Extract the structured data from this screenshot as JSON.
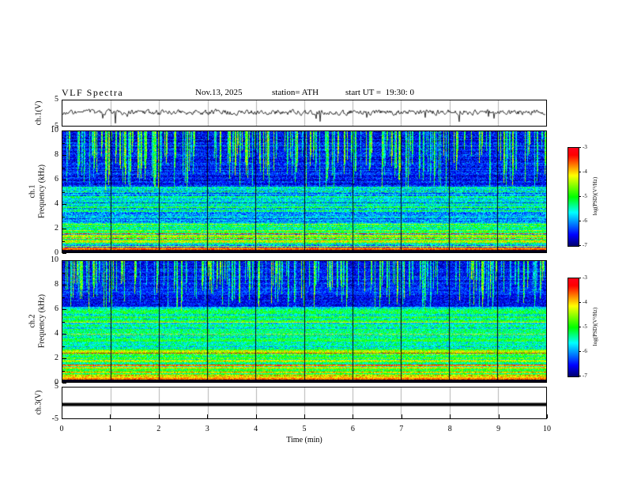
{
  "header": {
    "title": "VLF Spectra",
    "date": "Nov.13, 2025",
    "station": "station= ATH",
    "start_ut": "start UT =  19:30: 0"
  },
  "axes": {
    "x": {
      "label": "Time (min)",
      "min": 0,
      "max": 10,
      "ticks": [
        0,
        1,
        2,
        3,
        4,
        5,
        6,
        7,
        8,
        9,
        10
      ]
    },
    "voltage": {
      "min": -5,
      "max": 5,
      "tick_labels": [
        5,
        -5
      ]
    },
    "frequency": {
      "min": 0,
      "max": 10,
      "ticks": [
        0,
        2,
        4,
        6,
        8,
        10
      ],
      "minor_ticks": [
        1,
        3,
        5,
        7,
        9
      ]
    },
    "colorbar": {
      "label": "log(PSD)(V²/Hz)",
      "min": -7,
      "max": -3,
      "ticks": [
        -3,
        -4,
        -5,
        -6,
        -7
      ]
    }
  },
  "chart_data": [
    {
      "type": "line",
      "panel": "ch1-waveform",
      "ylabel": "ch.1(V)",
      "ylim": [
        -5,
        5
      ],
      "xlim": [
        0,
        10
      ],
      "description": "Broadband noisy voltage trace fluctuating around +0.3 V (~±1 V) with intermittent negative spikes reaching about -3 V",
      "signal": {
        "seed": 9,
        "mean": 0.3,
        "noise_amp": 0.8,
        "smooth": 0.45,
        "spike_rate": 0.02,
        "spike_scale": 1.6
      }
    },
    {
      "type": "heatmap",
      "panel": "ch1-spectrogram",
      "channel": "ch.1",
      "ylabel": "Frequency (kHz)",
      "ylim": [
        0,
        10
      ],
      "xlim": [
        0,
        10
      ],
      "value_range": [
        -7,
        -3
      ],
      "colorbar_label": "log(PSD)(V²/Hz)",
      "description": "VLF spectrogram: intense yellow-red horizontal bands below ~2.3 kHz, moderate blue-green 2.3-5.4 kHz with horizontal striping, dark blue above 5.4 kHz crossed by dense vertical sferic streaks; black vertical gridlines every minute",
      "texture": {
        "seed": 101,
        "bands": [
          {
            "f0": 0.0,
            "f1": 0.16,
            "base": -7.5,
            "rowVar": 0.05,
            "cellVar": 0.05,
            "lineProb": 0,
            "lineBoost": 0
          },
          {
            "f0": 0.16,
            "f1": 0.36,
            "base": -3.9,
            "rowVar": 0.35,
            "cellVar": 0.35,
            "lineProb": 0.4,
            "lineBoost": 0.5
          },
          {
            "f0": 0.36,
            "f1": 0.62,
            "base": -6.1,
            "rowVar": 0.5,
            "cellVar": 0.5,
            "lineProb": 0.25,
            "lineBoost": 1.5
          },
          {
            "f0": 0.62,
            "f1": 2.35,
            "base": -5.0,
            "rowVar": 0.85,
            "cellVar": 0.6,
            "lineProb": 0.2,
            "lineBoost": 1.2
          },
          {
            "f0": 2.35,
            "f1": 5.4,
            "base": -5.85,
            "rowVar": 0.5,
            "cellVar": 0.55,
            "lineProb": 0.12,
            "lineBoost": 0.9
          },
          {
            "f0": 5.4,
            "f1": 10.01,
            "base": -6.5,
            "rowVar": 0.22,
            "cellVar": 0.45,
            "lineProb": 0.04,
            "lineBoost": 0.5
          }
        ],
        "streaks": {
          "prob": 0.3,
          "fminLo": 5.0,
          "fminHi": 8.6,
          "level": -5.1,
          "levelVar": 0.7
        }
      }
    },
    {
      "type": "heatmap",
      "panel": "ch2-spectrogram",
      "channel": "ch.2",
      "ylabel": "Frequency (kHz)",
      "ylim": [
        0,
        10
      ],
      "xlim": [
        0,
        10
      ],
      "value_range": [
        -7,
        -3
      ],
      "colorbar_label": "log(PSD)(V²/Hz)",
      "description": "VLF spectrogram: green/yellow/red banded structure below ~2.6 kHz, greenish-cyan speckle 2.6-6.2 kHz, dark blue above 6.2 kHz with dense vertical sferic streaks; black vertical gridlines every minute",
      "texture": {
        "seed": 202,
        "bands": [
          {
            "f0": 0.0,
            "f1": 0.16,
            "base": -7.5,
            "rowVar": 0.05,
            "cellVar": 0.05,
            "lineProb": 0,
            "lineBoost": 0
          },
          {
            "f0": 0.16,
            "f1": 0.38,
            "base": -3.7,
            "rowVar": 0.35,
            "cellVar": 0.35,
            "lineProb": 0.4,
            "lineBoost": 0.4
          },
          {
            "f0": 0.38,
            "f1": 0.8,
            "base": -4.8,
            "rowVar": 0.6,
            "cellVar": 0.5,
            "lineProb": 0.3,
            "lineBoost": 1.0
          },
          {
            "f0": 0.8,
            "f1": 2.6,
            "base": -4.9,
            "rowVar": 0.8,
            "cellVar": 0.55,
            "lineProb": 0.2,
            "lineBoost": 1.2
          },
          {
            "f0": 2.6,
            "f1": 6.2,
            "base": -5.4,
            "rowVar": 0.45,
            "cellVar": 0.5,
            "lineProb": 0.1,
            "lineBoost": 0.8
          },
          {
            "f0": 6.2,
            "f1": 10.01,
            "base": -6.5,
            "rowVar": 0.2,
            "cellVar": 0.4,
            "lineProb": 0.03,
            "lineBoost": 0.5
          }
        ],
        "streaks": {
          "prob": 0.28,
          "fminLo": 5.8,
          "fminHi": 8.8,
          "level": -5.2,
          "levelVar": 0.7
        }
      }
    },
    {
      "type": "line",
      "panel": "ch3-waveform",
      "ylabel": "ch.3(V)",
      "ylim": [
        -5,
        5
      ],
      "xlim": [
        0,
        10
      ],
      "description": "Flat constant trace at about -0.5 V drawn as a thick black line (no signal on channel 3)",
      "signal": {
        "value": -0.5,
        "thickness": 4
      }
    }
  ]
}
